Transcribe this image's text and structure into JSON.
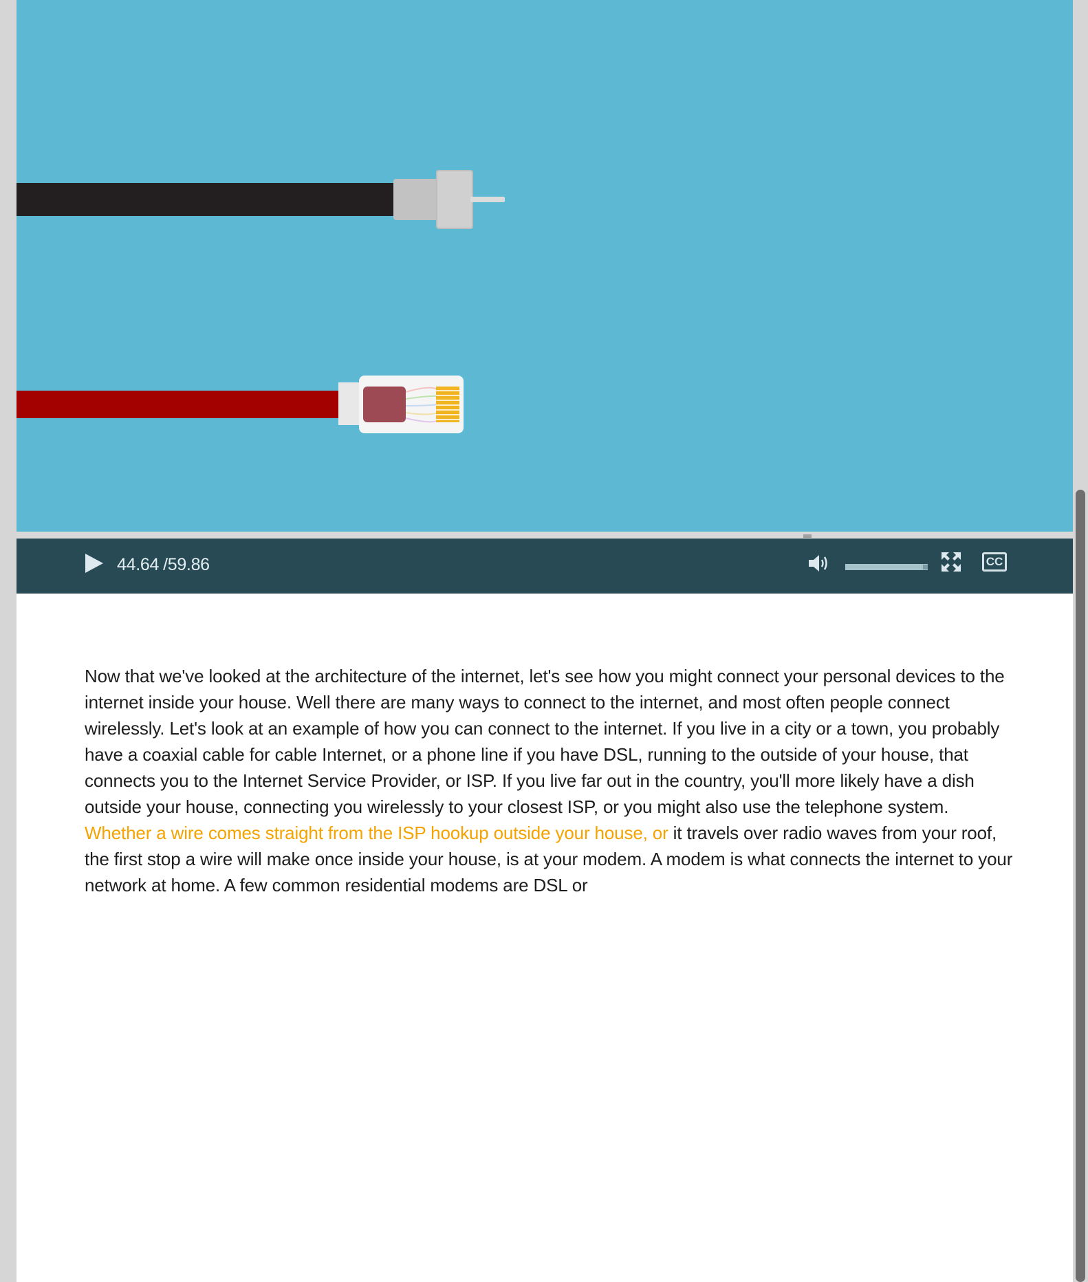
{
  "video": {
    "current_time": "44.64",
    "separator": "/",
    "duration": "59.86",
    "background_color": "#5db9d3",
    "cc_label": "CC",
    "playback_progress": 0.7457,
    "volume_level": 1.0
  },
  "controls": {
    "play_icon": "play-icon",
    "volume_icon": "volume-icon",
    "fullscreen_icon": "fullscreen-icon",
    "captions_icon": "closed-captions-icon"
  },
  "transcript": {
    "before_highlight": "Now that we've looked at the architecture of the internet, let's see how you might connect your personal devices to the internet inside your house. Well there are many ways to connect to the internet, and most often people connect wirelessly. Let's look at an example of how you can connect to the internet. If you live in a city or a town, you probably have a coaxial cable for cable Internet, or a phone line if you have DSL, running to the outside of your house, that connects you to the Internet Service Provider, or ISP. If you live far out in the country, you'll more likely have a dish outside your house, connecting you wirelessly to your closest ISP, or you might also use the telephone system. ",
    "highlight": "Whether a wire comes straight from the ISP hookup outside your house, or",
    "after_highlight": " it travels over radio waves from your roof, the first stop a wire will make once inside your house, is at your modem. A modem is what connects the internet to your network at home. A few common residential modems are DSL or",
    "highlight_color": "#f5a300"
  },
  "colors": {
    "control_bar": "#274a55",
    "page_background": "#d6d6d6"
  }
}
